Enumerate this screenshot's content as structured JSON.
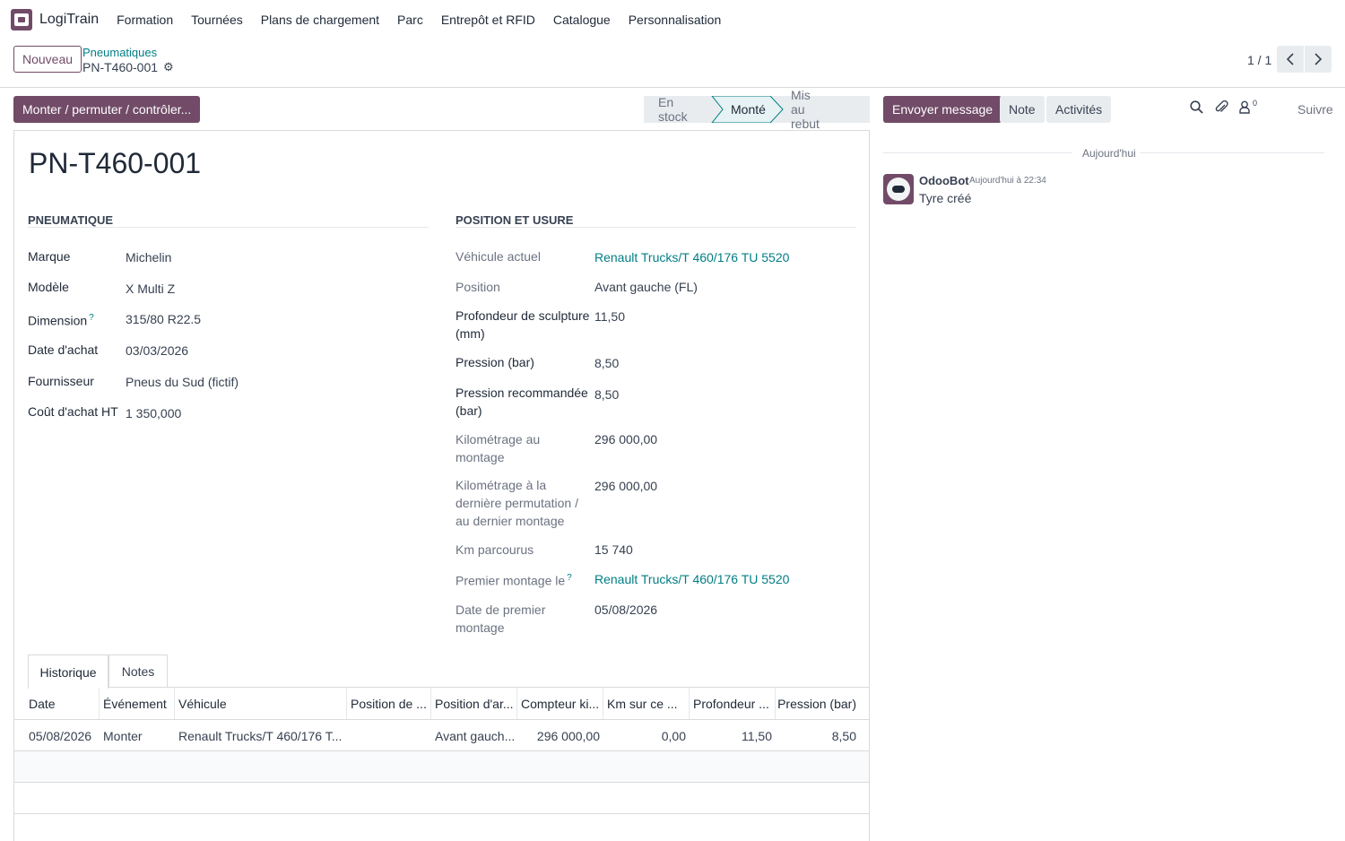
{
  "app": {
    "name": "LogiTrain"
  },
  "menu": [
    "Formation",
    "Tournées",
    "Plans de chargement",
    "Parc",
    "Entrepôt et RFID",
    "Catalogue",
    "Personnalisation"
  ],
  "control": {
    "new_label": "Nouveau",
    "breadcrumb_parent": "Pneumatiques",
    "breadcrumb_current": "PN-T460-001",
    "pager": "1 / 1"
  },
  "actions": {
    "primary": "Monter / permuter / contrôler..."
  },
  "status": {
    "stages": [
      "En stock",
      "Monté",
      "Mis au rebut"
    ],
    "active": "Monté"
  },
  "record": {
    "title": "PN-T460-001",
    "group_left_title": "Pneumatique",
    "group_right_title": "Position et usure",
    "left": [
      {
        "label": "Marque",
        "value": "Michelin"
      },
      {
        "label": "Modèle",
        "value": "X Multi Z"
      },
      {
        "label": "Dimension",
        "value": "315/80 R22.5",
        "help": "?"
      },
      {
        "label": "Date d'achat",
        "value": "03/03/2026"
      },
      {
        "label": "Fournisseur",
        "value": "Pneus du Sud (fictif)"
      },
      {
        "label": "Coût d'achat HT",
        "value": "1 350,000"
      }
    ],
    "right": [
      {
        "label": "Véhicule actuel",
        "value": "Renault Trucks/T 460/176 TU 5520"
      },
      {
        "label": "Position",
        "value": "Avant gauche (FL)"
      },
      {
        "label": "Profondeur de sculpture (mm)",
        "value": "11,50"
      },
      {
        "label": "Pression (bar)",
        "value": "8,50"
      },
      {
        "label": "Pression recommandée (bar)",
        "value": "8,50"
      },
      {
        "label": "Kilométrage au montage",
        "value": "296 000,00"
      },
      {
        "label": "Kilométrage à la dernière permutation / au dernier montage",
        "value": "296 000,00"
      },
      {
        "label": "Km parcourus",
        "value": "15 740"
      },
      {
        "label": "Premier montage le",
        "value": "Renault Trucks/T 460/176 TU 5520",
        "help": "?"
      },
      {
        "label": "Date de premier montage",
        "value": "05/08/2026"
      }
    ]
  },
  "tabs": [
    "Historique",
    "Notes"
  ],
  "history": {
    "columns": [
      "Date",
      "Événement",
      "Véhicule",
      "Position de ...",
      "Position d'ar...",
      "Compteur ki...",
      "Km sur ce ...",
      "Profondeur ...",
      "Pression (bar)"
    ],
    "rows": [
      [
        "05/08/2026",
        "Monter",
        "Renault Trucks/T 460/176 T...",
        "",
        "Avant gauch...",
        "296 000,00",
        "0,00",
        "11,50",
        "8,50"
      ]
    ]
  },
  "chatter": {
    "send_label": "Envoyer message",
    "note_label": "Note",
    "activities_label": "Activités",
    "followers_count": "0",
    "follow_label": "Suivre",
    "date_separator": "Aujourd'hui",
    "messages": [
      {
        "author": "OdooBot",
        "time": "Aujourd'hui à 22:34",
        "body": "Tyre créé"
      }
    ]
  },
  "colors": {
    "brand": "#714B67",
    "link": "#017e84"
  }
}
